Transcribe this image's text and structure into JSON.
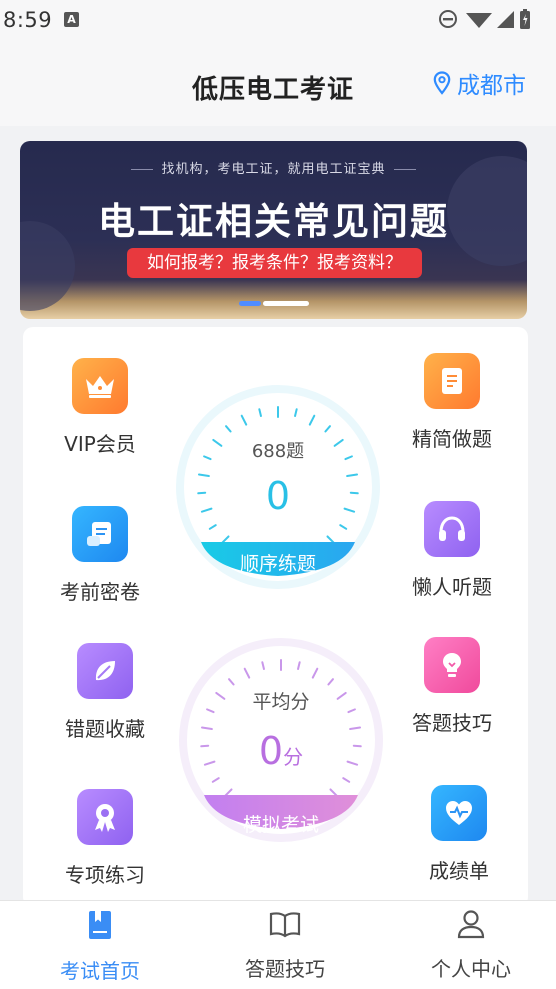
{
  "status": {
    "time": "8:59",
    "notif_letter": "A"
  },
  "header": {
    "title": "低压电工考证",
    "city": "成都市"
  },
  "banner": {
    "subtitle": "找机构，考电工证，就用电工证宝典",
    "title": "电工证相关常见问题",
    "pill": "如何报考？报考条件？报考资料？"
  },
  "features": {
    "vip": "VIP会员",
    "precise": "精简做题",
    "secret": "考前密卷",
    "listen": "懒人听题",
    "wrong": "错题收藏",
    "tips": "答题技巧",
    "special": "专项练习",
    "report": "成绩单"
  },
  "gauge_practice": {
    "count": "688题",
    "value": "0",
    "button": "顺序练题"
  },
  "gauge_exam": {
    "label": "平均分",
    "value": "0",
    "unit": "分",
    "button": "模拟考试"
  },
  "nav": {
    "home": "考试首页",
    "tips": "答题技巧",
    "me": "个人中心"
  },
  "colors": {
    "accent": "#2e8bff",
    "cyan": "#29c0e6",
    "purple": "#b86fe0"
  }
}
